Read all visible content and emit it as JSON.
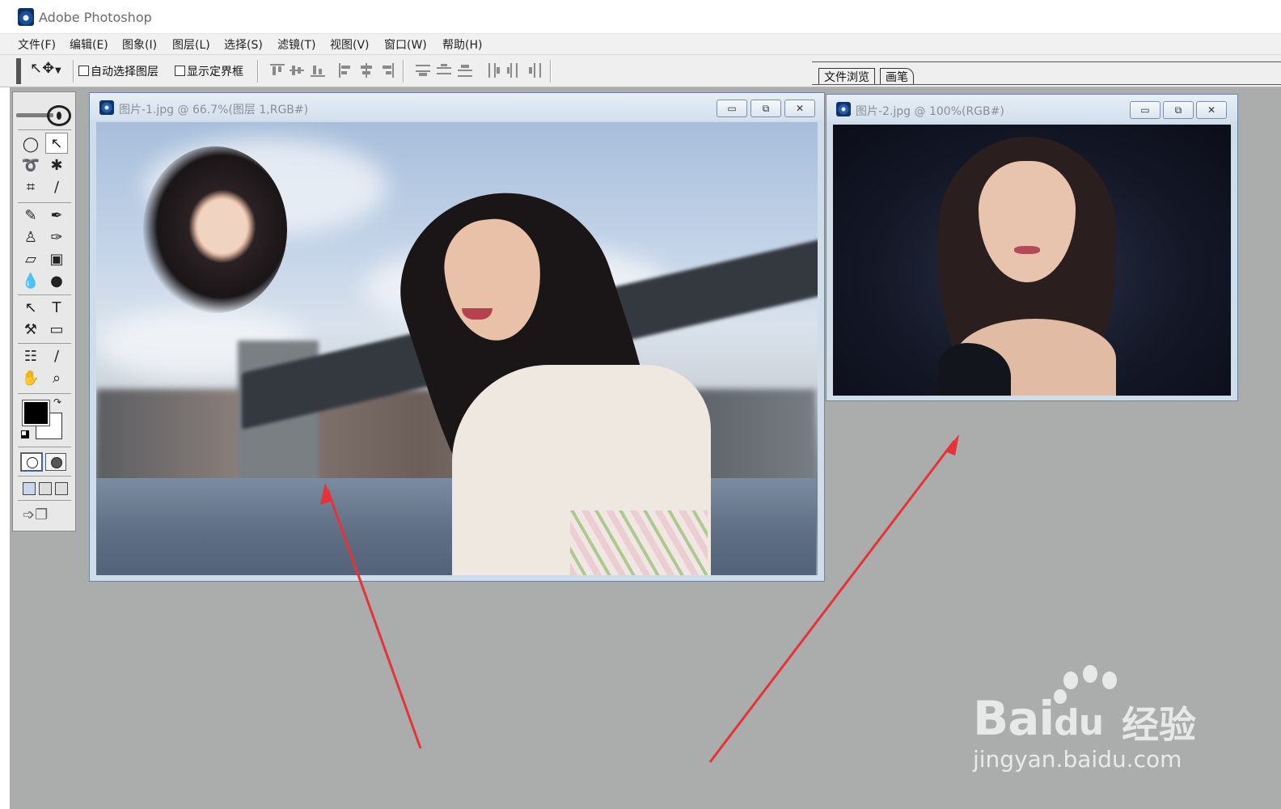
{
  "app": {
    "title": "Adobe Photoshop"
  },
  "menu": [
    "文件(F)",
    "编辑(E)",
    "图象(I)",
    "图层(L)",
    "选择(S)",
    "滤镜(T)",
    "视图(V)",
    "窗口(W)",
    "帮助(H)"
  ],
  "options": {
    "auto_select_label": "自动选择图层",
    "show_bounds_label": "显示定界框"
  },
  "palette_well": {
    "tabs": [
      "文件浏览",
      "画笔"
    ]
  },
  "documents": [
    {
      "title": "图片-1.jpg @ 66.7%(图层 1,RGB#)",
      "zoom": "66.7%"
    },
    {
      "title": "图片-2.jpg @ 100%(RGB#)",
      "zoom": "100%"
    }
  ],
  "window_buttons": {
    "minimize": "▭",
    "maximize": "⧉",
    "close": "✕"
  },
  "colors": {
    "foreground": "#000000",
    "background": "#ffffff",
    "annotation_arrow": "#e8323a"
  },
  "watermark": {
    "brand": "Bai",
    "brand_tail": "du",
    "cn": "经验",
    "url": "jingyan.baidu.com"
  }
}
